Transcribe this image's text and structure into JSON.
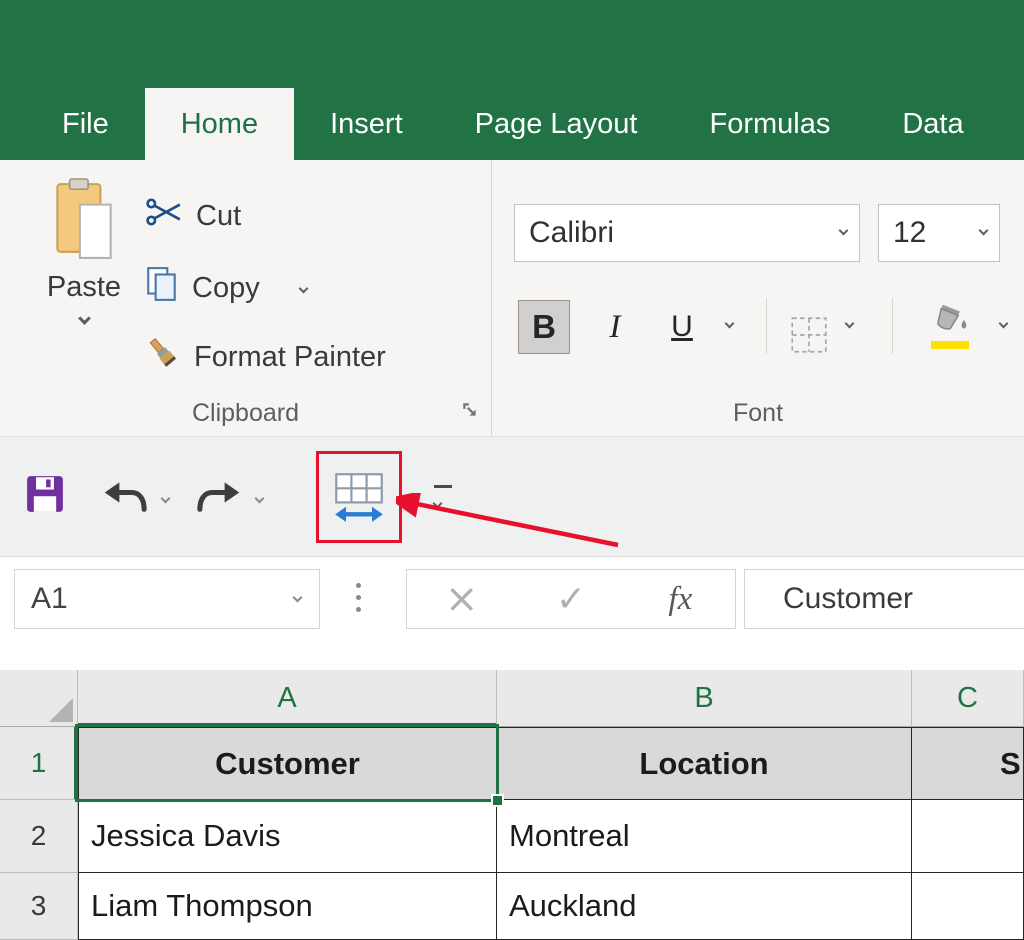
{
  "ribbon": {
    "tabs": [
      {
        "label": "File"
      },
      {
        "label": "Home"
      },
      {
        "label": "Insert"
      },
      {
        "label": "Page Layout"
      },
      {
        "label": "Formulas"
      },
      {
        "label": "Data"
      }
    ],
    "clipboard": {
      "group_label": "Clipboard",
      "paste": "Paste",
      "cut": "Cut",
      "copy": "Copy",
      "format_painter": "Format Painter"
    },
    "font_group": {
      "group_label": "Font",
      "font_name": "Calibri",
      "font_size": "12",
      "bold": "B",
      "italic": "I",
      "underline": "U"
    }
  },
  "qat": {
    "icons": [
      "save",
      "undo",
      "redo",
      "autofit-column-width",
      "customize-quick-access-toolbar"
    ]
  },
  "formula_bar": {
    "name_box": "A1",
    "cancel": "×",
    "enter": "✓",
    "fx": "fx",
    "value": "Customer"
  },
  "grid": {
    "column_headers": [
      "A",
      "B",
      "C"
    ],
    "selected_cell": "A1",
    "rows": [
      {
        "num": "1",
        "cells": [
          "Customer",
          "Location",
          "S"
        ]
      },
      {
        "num": "2",
        "cells": [
          "Jessica Davis",
          "Montreal",
          ""
        ]
      },
      {
        "num": "3",
        "cells": [
          "Liam Thompson",
          "Auckland",
          ""
        ]
      }
    ]
  },
  "colors": {
    "excel_green": "#217346",
    "annotation_red": "#e8112d",
    "highlight_yellow": "#ffe100",
    "accent_blue": "#2b7cd3"
  }
}
